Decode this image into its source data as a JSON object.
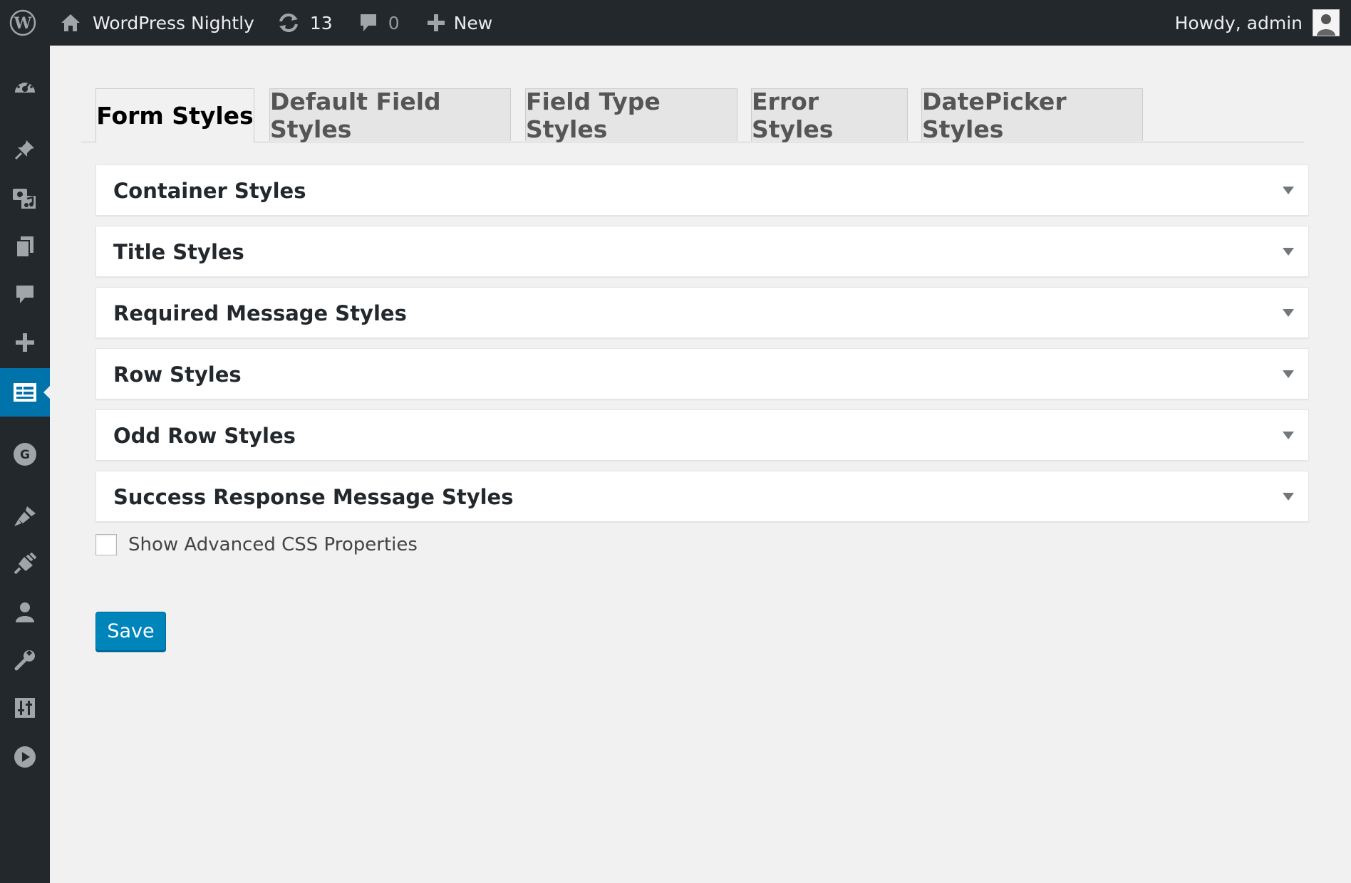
{
  "adminbar": {
    "site_name": "WordPress Nightly",
    "updates_count": "13",
    "comments_count": "0",
    "new_label": "New",
    "account_label": "Howdy, admin"
  },
  "sidebar": {
    "items": [
      {
        "icon": "dashboard-icon"
      },
      {
        "icon": "pin-icon"
      },
      {
        "icon": "media-icon"
      },
      {
        "icon": "pages-icon"
      },
      {
        "icon": "comments-icon"
      },
      {
        "icon": "plus-icon"
      },
      {
        "icon": "forms-icon",
        "current": true
      },
      {
        "icon": "g-icon"
      },
      {
        "icon": "appearance-icon"
      },
      {
        "icon": "plugins-icon"
      },
      {
        "icon": "users-icon"
      },
      {
        "icon": "tools-icon"
      },
      {
        "icon": "settings-icon"
      },
      {
        "icon": "play-icon"
      }
    ]
  },
  "tabs": [
    {
      "label": "Form Styles",
      "active": true
    },
    {
      "label": "Default Field Styles"
    },
    {
      "label": "Field Type Styles"
    },
    {
      "label": "Error Styles"
    },
    {
      "label": "DatePicker Styles"
    }
  ],
  "panels": [
    "Container Styles",
    "Title Styles",
    "Required Message Styles",
    "Row Styles",
    "Odd Row Styles",
    "Success Response Message Styles"
  ],
  "advanced": {
    "label": "Show Advanced CSS Properties",
    "checked": false
  },
  "save_label": "Save",
  "colors": {
    "adminbar_bg": "#23282d",
    "accent": "#0073aa",
    "button": "#0085ba",
    "background": "#f1f1f1"
  }
}
